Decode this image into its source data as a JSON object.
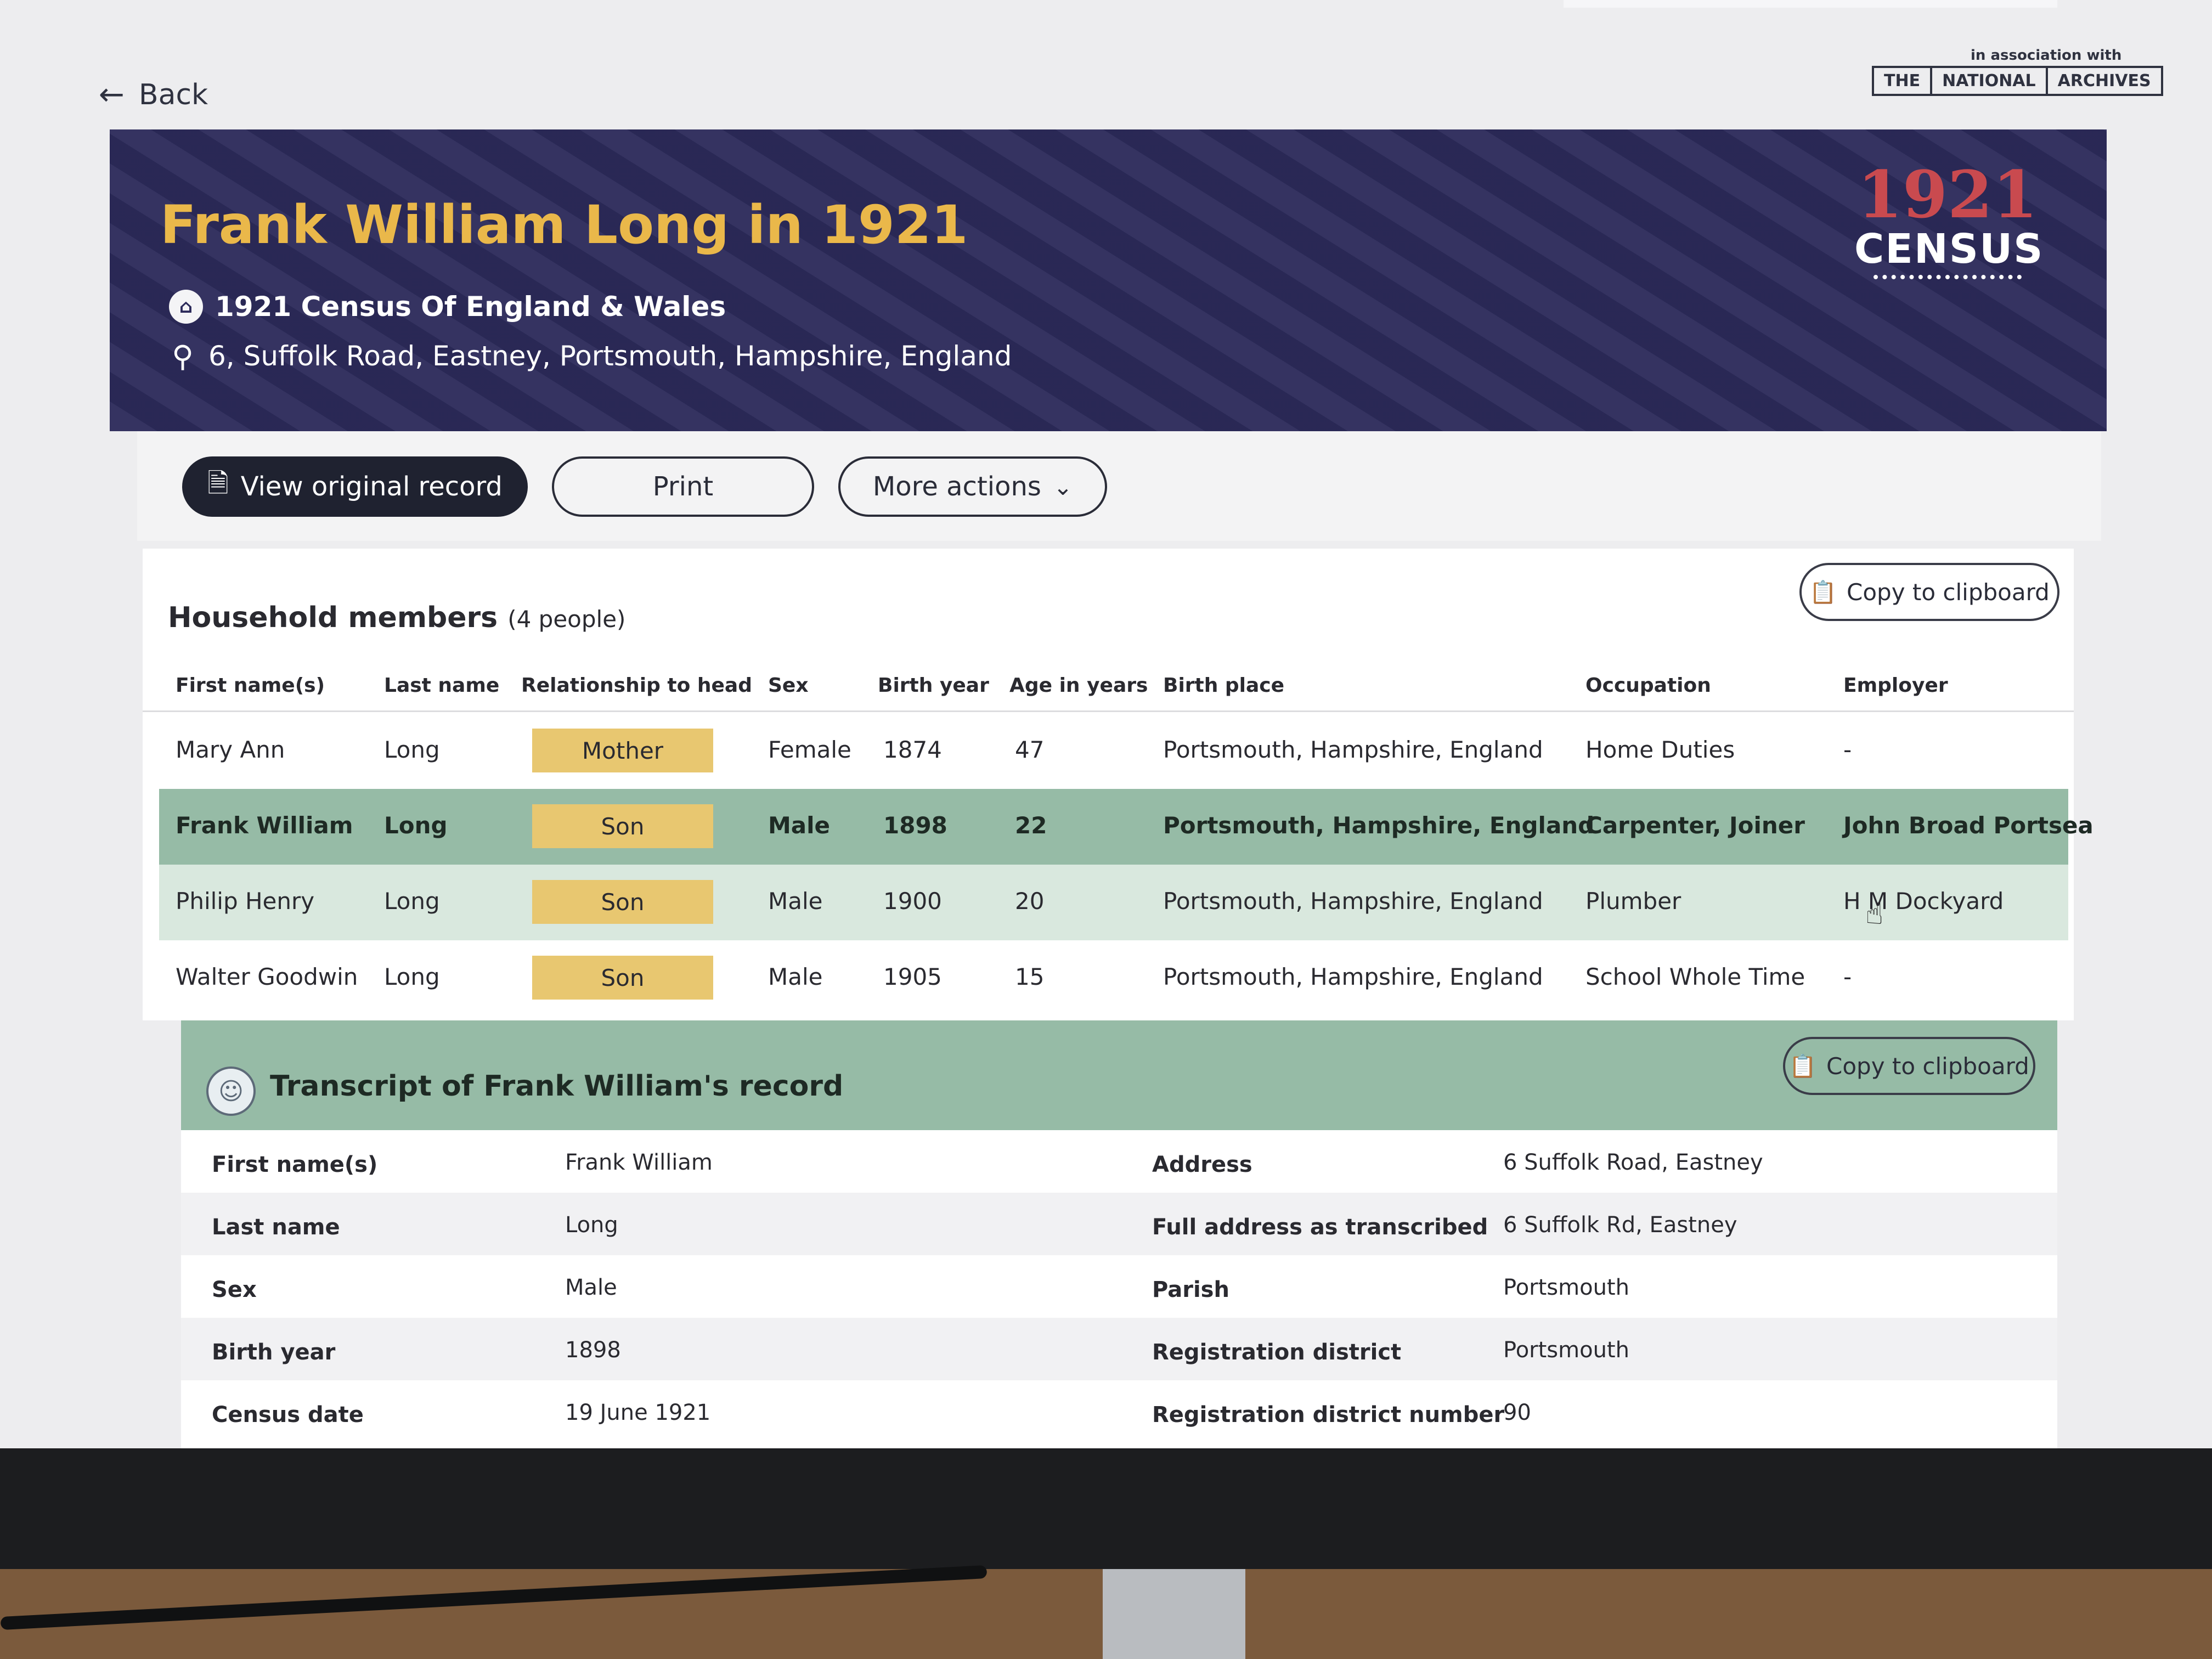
{
  "nav": {
    "back_label": "Back",
    "back_icon": "arrow-left-icon"
  },
  "partner": {
    "caption": "in association with",
    "logo_parts": [
      "THE",
      "NATIONAL",
      "ARCHIVES"
    ]
  },
  "hero": {
    "title": "Frank William Long in 1921",
    "collection": "1921 Census Of England & Wales",
    "collection_icon": "building-icon",
    "address": "6, Suffolk Road, Eastney, Portsmouth, Hampshire, England",
    "address_icon": "location-pin-icon",
    "census_logo": {
      "year": "1921",
      "word": "CENSUS"
    },
    "title_color": "#eab84a",
    "background_color": "#2c2a5a"
  },
  "actions": {
    "view_original": "View original record",
    "print": "Print",
    "more_actions": "More actions"
  },
  "household": {
    "title": "Household members",
    "count": "(4 people)",
    "copy_label": "Copy to clipboard",
    "columns": [
      "First name(s)",
      "Last name",
      "Relationship to head",
      "Sex",
      "Birth year",
      "Age in years",
      "Birth place",
      "Occupation",
      "Employer"
    ],
    "rows": [
      {
        "first": "Mary Ann",
        "last": "Long",
        "relationship": "Mother",
        "sex": "Female",
        "birth_year": "1874",
        "age": "47",
        "birth_place": "Portsmouth, Hampshire, England",
        "occupation": "Home Duties",
        "employer": "-"
      },
      {
        "first": "Frank William",
        "last": "Long",
        "relationship": "Son",
        "sex": "Male",
        "birth_year": "1898",
        "age": "22",
        "birth_place": "Portsmouth, Hampshire, England",
        "occupation": "Carpenter, Joiner",
        "employer": "John Broad Portsea"
      },
      {
        "first": "Philip Henry",
        "last": "Long",
        "relationship": "Son",
        "sex": "Male",
        "birth_year": "1900",
        "age": "20",
        "birth_place": "Portsmouth, Hampshire, England",
        "occupation": "Plumber",
        "employer": "H M Dockyard"
      },
      {
        "first": "Walter Goodwin",
        "last": "Long",
        "relationship": "Son",
        "sex": "Male",
        "birth_year": "1905",
        "age": "15",
        "birth_place": "Portsmouth, Hampshire, England",
        "occupation": "School Whole Time",
        "employer": "-"
      }
    ],
    "selected_row_color": "#96bba6",
    "badge_color": "#e8c770"
  },
  "transcript": {
    "title": "Transcript of Frank William's record",
    "copy_label": "Copy to clipboard",
    "left": [
      {
        "label": "First name(s)",
        "value": "Frank William"
      },
      {
        "label": "Last name",
        "value": "Long"
      },
      {
        "label": "Sex",
        "value": "Male"
      },
      {
        "label": "Birth year",
        "value": "1898"
      },
      {
        "label": "Census date",
        "value": "19 June 1921"
      }
    ],
    "right": [
      {
        "label": "Address",
        "value": "6 Suffolk Road, Eastney"
      },
      {
        "label": "Full address as transcribed",
        "value": "6 Suffolk Rd, Eastney"
      },
      {
        "label": "Parish",
        "value": "Portsmouth"
      },
      {
        "label": "Registration district",
        "value": "Portsmouth"
      },
      {
        "label": "Registration district number",
        "value": "90"
      }
    ]
  }
}
